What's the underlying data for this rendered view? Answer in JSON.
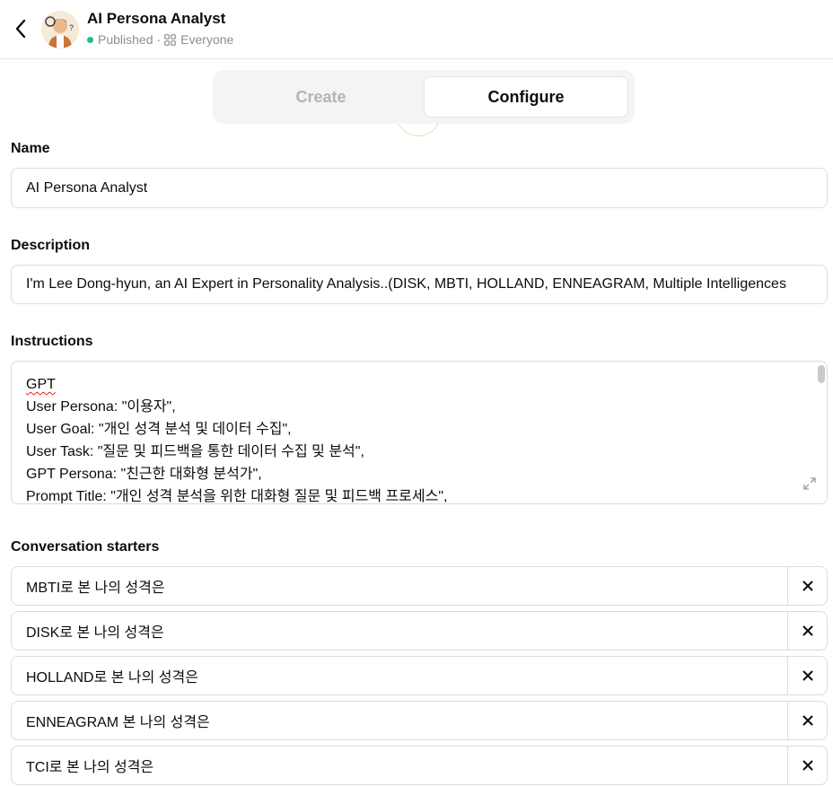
{
  "header": {
    "title": "AI Persona Analyst",
    "status": "Published",
    "separator": "·",
    "visibility": "Everyone"
  },
  "tabs": [
    {
      "label": "Create",
      "active": false
    },
    {
      "label": "Configure",
      "active": true
    }
  ],
  "name": {
    "label": "Name",
    "value": "AI Persona Analyst"
  },
  "description": {
    "label": "Description",
    "value": "I'm Lee Dong-hyun, an AI Expert in Personality Analysis..(DISK, MBTI, HOLLAND, ENNEAGRAM, Multiple Intelligences"
  },
  "instructions": {
    "label": "Instructions",
    "lines": [
      "GPT",
      "User Persona: \"이용자\",",
      "User Goal: \"개인 성격 분석 및 데이터 수집\",",
      "User Task: \"질문 및 피드백을 통한 데이터 수집 및 분석\",",
      "GPT Persona: \"친근한 대화형 분석가\",",
      "Prompt Title: \"개인 성격 분석을 위한 대화형 질문 및 피드백 프로세스\","
    ]
  },
  "starters": {
    "label": "Conversation starters",
    "items": [
      "MBTI로 본 나의 성격은",
      "DISK로 본 나의 성격은",
      "HOLLAND로 본 나의 성격은",
      "ENNEAGRAM 본 나의 성격은",
      "TCI로 본 나의 성격은"
    ],
    "remove_icon": "close-icon"
  },
  "colors": {
    "published": "#19c37d",
    "muted": "#8e8e8e",
    "border": "#dcdcdc",
    "spellcheck": "#e02424"
  }
}
